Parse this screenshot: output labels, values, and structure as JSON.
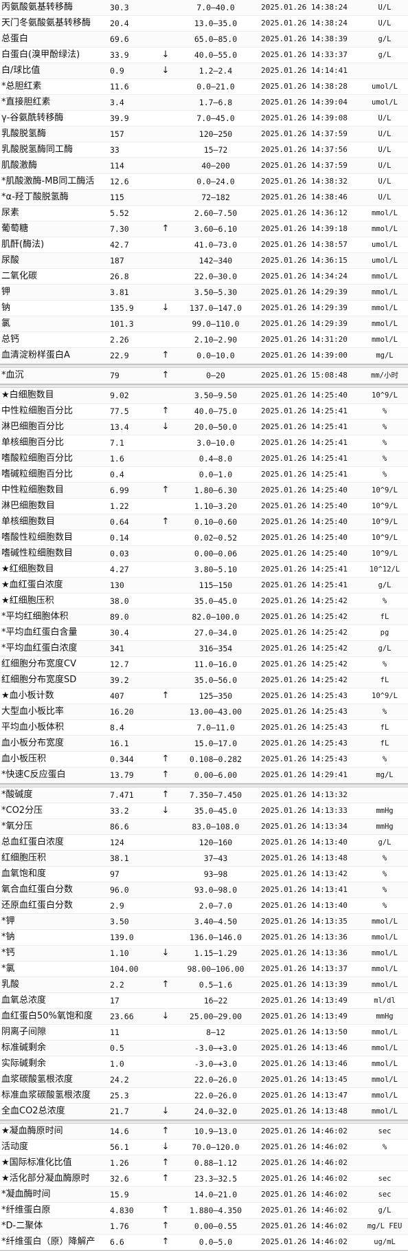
{
  "sections": [
    {
      "rows": [
        {
          "name": "丙氨酸氨基转移酶",
          "value": "30.3",
          "flag": "",
          "ref": "7.0—40.0",
          "time": "2025.01.26 14:38:24",
          "unit": "U/L"
        },
        {
          "name": "天门冬氨酸氨基转移酶",
          "value": "20.4",
          "flag": "",
          "ref": "13.0—35.0",
          "time": "2025.01.26 14:38:24",
          "unit": "U/L"
        },
        {
          "name": "总蛋白",
          "value": "69.6",
          "flag": "",
          "ref": "65.0—85.0",
          "time": "2025.01.26 14:38:39",
          "unit": "g/L"
        },
        {
          "name": "白蛋白(溴甲酚绿法)",
          "value": "33.9",
          "flag": "↓",
          "ref": "40.0—55.0",
          "time": "2025.01.26 14:33:37",
          "unit": "g/L"
        },
        {
          "name": "白/球比值",
          "value": "0.9",
          "flag": "↓",
          "ref": "1.2—2.4",
          "time": "2025.01.26 14:14:41",
          "unit": ""
        },
        {
          "name": "*总胆红素",
          "value": "11.6",
          "flag": "",
          "ref": "0.0—21.0",
          "time": "2025.01.26 14:38:28",
          "unit": "umol/L"
        },
        {
          "name": "*直接胆红素",
          "value": "3.4",
          "flag": "",
          "ref": "1.7—6.8",
          "time": "2025.01.26 14:39:04",
          "unit": "umol/L"
        },
        {
          "name": "γ-谷氨酰转移酶",
          "value": "39.9",
          "flag": "",
          "ref": "7.0—45.0",
          "time": "2025.01.26 14:39:08",
          "unit": "U/L"
        },
        {
          "name": "乳酸脱氢酶",
          "value": "157",
          "flag": "",
          "ref": "120—250",
          "time": "2025.01.26 14:37:59",
          "unit": "U/L"
        },
        {
          "name": "乳酸脱氢酶同工酶",
          "value": "33",
          "flag": "",
          "ref": "15—72",
          "time": "2025.01.26 14:37:56",
          "unit": "U/L"
        },
        {
          "name": "肌酸激酶",
          "value": "114",
          "flag": "",
          "ref": "40—200",
          "time": "2025.01.26 14:37:59",
          "unit": "U/L"
        },
        {
          "name": "*肌酸激酶-MB同工酶活",
          "value": "12.6",
          "flag": "",
          "ref": "0.0—24.0",
          "time": "2025.01.26 14:38:32",
          "unit": "U/L"
        },
        {
          "name": "*α-羟丁酸脱氢酶",
          "value": "115",
          "flag": "",
          "ref": "72—182",
          "time": "2025.01.26 14:38:46",
          "unit": "U/L"
        },
        {
          "name": "尿素",
          "value": "5.52",
          "flag": "",
          "ref": "2.60—7.50",
          "time": "2025.01.26 14:36:12",
          "unit": "mmol/L"
        },
        {
          "name": "葡萄糖",
          "value": "7.30",
          "flag": "↑",
          "ref": "3.60—6.10",
          "time": "2025.01.26 14:39:18",
          "unit": "mmol/L"
        },
        {
          "name": "肌酐(酶法)",
          "value": "42.7",
          "flag": "",
          "ref": "41.0—73.0",
          "time": "2025.01.26 14:38:57",
          "unit": "umol/L"
        },
        {
          "name": "尿酸",
          "value": "187",
          "flag": "",
          "ref": "142—340",
          "time": "2025.01.26 14:36:15",
          "unit": "umol/L"
        },
        {
          "name": "二氧化碳",
          "value": "26.8",
          "flag": "",
          "ref": "22.0—30.0",
          "time": "2025.01.26 14:34:24",
          "unit": "mmol/L"
        },
        {
          "name": "钾",
          "value": "3.81",
          "flag": "",
          "ref": "3.50—5.30",
          "time": "2025.01.26 14:29:39",
          "unit": "mmol/L"
        },
        {
          "name": "钠",
          "value": "135.9",
          "flag": "↓",
          "ref": "137.0—147.0",
          "time": "2025.01.26 14:29:39",
          "unit": "mmol/L"
        },
        {
          "name": "氯",
          "value": "101.3",
          "flag": "",
          "ref": "99.0—110.0",
          "time": "2025.01.26 14:29:39",
          "unit": "mmol/L"
        },
        {
          "name": "总钙",
          "value": "2.26",
          "flag": "",
          "ref": "2.10—2.90",
          "time": "2025.01.26 14:31:20",
          "unit": "mmol/L"
        },
        {
          "name": "血清淀粉样蛋白A",
          "value": "22.9",
          "flag": "↑",
          "ref": "0.0—10.0",
          "time": "2025.01.26 14:39:00",
          "unit": "mg/L"
        }
      ]
    },
    {
      "rows": [
        {
          "name": "*血沉",
          "value": "79",
          "flag": "↑",
          "ref": "0—20",
          "time": "2025.01.26 15:08:48",
          "unit": "mm/小时"
        }
      ]
    },
    {
      "rows": [
        {
          "name": "★白细胞数目",
          "value": "9.02",
          "flag": "",
          "ref": "3.50—9.50",
          "time": "2025.01.26 14:25:40",
          "unit": "10^9/L"
        },
        {
          "name": "中性粒细胞百分比",
          "value": "77.5",
          "flag": "↑",
          "ref": "40.0—75.0",
          "time": "2025.01.26 14:25:41",
          "unit": "%"
        },
        {
          "name": "淋巴细胞百分比",
          "value": "13.4",
          "flag": "↓",
          "ref": "20.0—50.0",
          "time": "2025.01.26 14:25:41",
          "unit": "%"
        },
        {
          "name": "单核细胞百分比",
          "value": "7.1",
          "flag": "",
          "ref": "3.0—10.0",
          "time": "2025.01.26 14:25:41",
          "unit": "%"
        },
        {
          "name": "嗜酸粒细胞百分比",
          "value": "1.6",
          "flag": "",
          "ref": "0.4—8.0",
          "time": "2025.01.26 14:25:41",
          "unit": "%"
        },
        {
          "name": "嗜碱粒细胞百分比",
          "value": "0.4",
          "flag": "",
          "ref": "0.0—1.0",
          "time": "2025.01.26 14:25:41",
          "unit": "%"
        },
        {
          "name": "中性粒细胞数目",
          "value": "6.99",
          "flag": "↑",
          "ref": "1.80—6.30",
          "time": "2025.01.26 14:25:40",
          "unit": "10^9/L"
        },
        {
          "name": "淋巴细胞数目",
          "value": "1.22",
          "flag": "",
          "ref": "1.10—3.20",
          "time": "2025.01.26 14:25:40",
          "unit": "10^9/L"
        },
        {
          "name": "单核细胞数目",
          "value": "0.64",
          "flag": "↑",
          "ref": "0.10—0.60",
          "time": "2025.01.26 14:25:40",
          "unit": "10^9/L"
        },
        {
          "name": "嗜酸性粒细胞数目",
          "value": "0.14",
          "flag": "",
          "ref": "0.02—0.52",
          "time": "2025.01.26 14:25:40",
          "unit": "10^9/L"
        },
        {
          "name": "嗜碱性粒细胞数目",
          "value": "0.03",
          "flag": "",
          "ref": "0.00—0.06",
          "time": "2025.01.26 14:25:40",
          "unit": "10^9/L"
        },
        {
          "name": "★红细胞数目",
          "value": "4.27",
          "flag": "",
          "ref": "3.80—5.10",
          "time": "2025.01.26 14:25:41",
          "unit": "10^12/L"
        },
        {
          "name": "★血红蛋白浓度",
          "value": "130",
          "flag": "",
          "ref": "115—150",
          "time": "2025.01.26 14:25:41",
          "unit": "g/L"
        },
        {
          "name": "★红细胞压积",
          "value": "38.0",
          "flag": "",
          "ref": "35.0—45.0",
          "time": "2025.01.26 14:25:42",
          "unit": "%"
        },
        {
          "name": "*平均红细胞体积",
          "value": "89.0",
          "flag": "",
          "ref": "82.0—100.0",
          "time": "2025.01.26 14:25:42",
          "unit": "fL"
        },
        {
          "name": "*平均血红蛋白含量",
          "value": "30.4",
          "flag": "",
          "ref": "27.0—34.0",
          "time": "2025.01.26 14:25:42",
          "unit": "pg"
        },
        {
          "name": "*平均血红蛋白浓度",
          "value": "341",
          "flag": "",
          "ref": "316—354",
          "time": "2025.01.26 14:25:42",
          "unit": "g/L"
        },
        {
          "name": "红细胞分布宽度CV",
          "value": "12.7",
          "flag": "",
          "ref": "11.0—16.0",
          "time": "2025.01.26 14:25:42",
          "unit": "%"
        },
        {
          "name": "红细胞分布宽度SD",
          "value": "39.2",
          "flag": "",
          "ref": "35.0—56.0",
          "time": "2025.01.26 14:25:42",
          "unit": "fL"
        },
        {
          "name": "★血小板计数",
          "value": "407",
          "flag": "↑",
          "ref": "125—350",
          "time": "2025.01.26 14:25:43",
          "unit": "10^9/L"
        },
        {
          "name": "大型血小板比率",
          "value": "16.20",
          "flag": "",
          "ref": "13.00—43.00",
          "time": "2025.01.26 14:25:43",
          "unit": "%"
        },
        {
          "name": "平均血小板体积",
          "value": "8.4",
          "flag": "",
          "ref": "7.0—11.0",
          "time": "2025.01.26 14:25:43",
          "unit": "fL"
        },
        {
          "name": "血小板分布宽度",
          "value": "16.1",
          "flag": "",
          "ref": "15.0—17.0",
          "time": "2025.01.26 14:25:43",
          "unit": "fL"
        },
        {
          "name": "血小板压积",
          "value": "0.344",
          "flag": "↑",
          "ref": "0.108—0.282",
          "time": "2025.01.26 14:25:43",
          "unit": "%"
        },
        {
          "name": "*快速C反应蛋白",
          "value": "13.79",
          "flag": "↑",
          "ref": "0.00—6.00",
          "time": "2025.01.26 14:29:41",
          "unit": "mg/L"
        }
      ]
    },
    {
      "rows": [
        {
          "name": "*酸碱度",
          "value": "7.471",
          "flag": "↑",
          "ref": "7.350—7.450",
          "time": "2025.01.26 14:13:32",
          "unit": ""
        },
        {
          "name": "*CO2分压",
          "value": "33.2",
          "flag": "↓",
          "ref": "35.0—45.0",
          "time": "2025.01.26 14:13:33",
          "unit": "mmHg"
        },
        {
          "name": "*氧分压",
          "value": "86.6",
          "flag": "",
          "ref": "83.0—108.0",
          "time": "2025.01.26 14:13:34",
          "unit": "mmHg"
        },
        {
          "name": "总血红蛋白浓度",
          "value": "124",
          "flag": "",
          "ref": "120—160",
          "time": "2025.01.26 14:13:40",
          "unit": "g/L"
        },
        {
          "name": "红细胞压积",
          "value": "38.1",
          "flag": "",
          "ref": "37—43",
          "time": "2025.01.26 14:13:48",
          "unit": "%"
        },
        {
          "name": "血氧饱和度",
          "value": "97",
          "flag": "",
          "ref": "93—98",
          "time": "2025.01.26 14:13:42",
          "unit": "%"
        },
        {
          "name": "氧合血红蛋白分数",
          "value": "96.0",
          "flag": "",
          "ref": "93.0—98.0",
          "time": "2025.01.26 14:13:41",
          "unit": "%"
        },
        {
          "name": "还原血红蛋白分数",
          "value": "2.9",
          "flag": "",
          "ref": "2.0—7.0",
          "time": "2025.01.26 14:13:40",
          "unit": "%"
        },
        {
          "name": "*钾",
          "value": "3.50",
          "flag": "",
          "ref": "3.40—4.50",
          "time": "2025.01.26 14:13:35",
          "unit": "mmol/L"
        },
        {
          "name": "*钠",
          "value": "139.0",
          "flag": "",
          "ref": "136.0—146.0",
          "time": "2025.01.26 14:13:36",
          "unit": "mmol/L"
        },
        {
          "name": "*钙",
          "value": "1.10",
          "flag": "↓",
          "ref": "1.15—1.29",
          "time": "2025.01.26 14:13:36",
          "unit": "mmol/L"
        },
        {
          "name": "*氯",
          "value": "104.00",
          "flag": "",
          "ref": "98.00—106.00",
          "time": "2025.01.26 14:13:37",
          "unit": "mmol/L"
        },
        {
          "name": "乳酸",
          "value": "2.2",
          "flag": "↑",
          "ref": "0.5—1.6",
          "time": "2025.01.26 14:13:39",
          "unit": "mmol/L"
        },
        {
          "name": "血氧总浓度",
          "value": "17",
          "flag": "",
          "ref": "16—22",
          "time": "2025.01.26 14:13:49",
          "unit": "ml/dl"
        },
        {
          "name": "血红蛋白50%氧饱和度",
          "value": "23.66",
          "flag": "↓",
          "ref": "25.00—29.00",
          "time": "2025.01.26 14:13:49",
          "unit": "mmHg"
        },
        {
          "name": "阴离子间隙",
          "value": "11",
          "flag": "",
          "ref": "8—12",
          "time": "2025.01.26 14:13:50",
          "unit": "mmol/L"
        },
        {
          "name": "标准碱剩余",
          "value": "0.5",
          "flag": "",
          "ref": "-3.0—+3.0",
          "time": "2025.01.26 14:13:46",
          "unit": "mmol/L"
        },
        {
          "name": "实际碱剩余",
          "value": "1.0",
          "flag": "",
          "ref": "-3.0—+3.0",
          "time": "2025.01.26 14:13:46",
          "unit": "mmol/L"
        },
        {
          "name": "血浆碳酸氢根浓度",
          "value": "24.2",
          "flag": "",
          "ref": "22.0—26.0",
          "time": "2025.01.26 14:13:45",
          "unit": "mmol/L"
        },
        {
          "name": "标准血浆碳酸氢根浓度",
          "value": "25.3",
          "flag": "",
          "ref": "22.0—26.0",
          "time": "2025.01.26 14:13:47",
          "unit": "mmol/L"
        },
        {
          "name": "全血CO2总浓度",
          "value": "21.7",
          "flag": "↓",
          "ref": "24.0—32.0",
          "time": "2025.01.26 14:13:48",
          "unit": "mmol/L"
        }
      ]
    },
    {
      "rows": [
        {
          "name": "★凝血酶原时间",
          "value": "14.6",
          "flag": "↑",
          "ref": "10.9—13.0",
          "time": "2025.01.26 14:46:02",
          "unit": "sec"
        },
        {
          "name": "活动度",
          "value": "56.1",
          "flag": "↓",
          "ref": "70.0—120.0",
          "time": "2025.01.26 14:46:02",
          "unit": "%"
        },
        {
          "name": "★国际标准化比值",
          "value": "1.26",
          "flag": "↑",
          "ref": "0.88—1.12",
          "time": "2025.01.26 14:46:02",
          "unit": ""
        },
        {
          "name": "★活化部分凝血酶原时",
          "value": "32.6",
          "flag": "↑",
          "ref": "23.3—32.5",
          "time": "2025.01.26 14:46:02",
          "unit": "sec"
        },
        {
          "name": "*凝血酶时间",
          "value": "15.9",
          "flag": "",
          "ref": "14.0—21.0",
          "time": "2025.01.26 14:46:02",
          "unit": "sec"
        },
        {
          "name": "*纤维蛋白原",
          "value": "4.830",
          "flag": "↑",
          "ref": "1.880—4.350",
          "time": "2025.01.26 14:46:02",
          "unit": "g/L"
        },
        {
          "name": "*D-二聚体",
          "value": "1.76",
          "flag": "↑",
          "ref": "0.00—0.55",
          "time": "2025.01.26 14:46:02",
          "unit": "mg/L FEU"
        },
        {
          "name": "*纤维蛋白（原）降解产",
          "value": "6.6",
          "flag": "↑",
          "ref": "0.0—5.0",
          "time": "2025.01.26 14:46:02",
          "unit": "ug/mL"
        }
      ]
    }
  ]
}
